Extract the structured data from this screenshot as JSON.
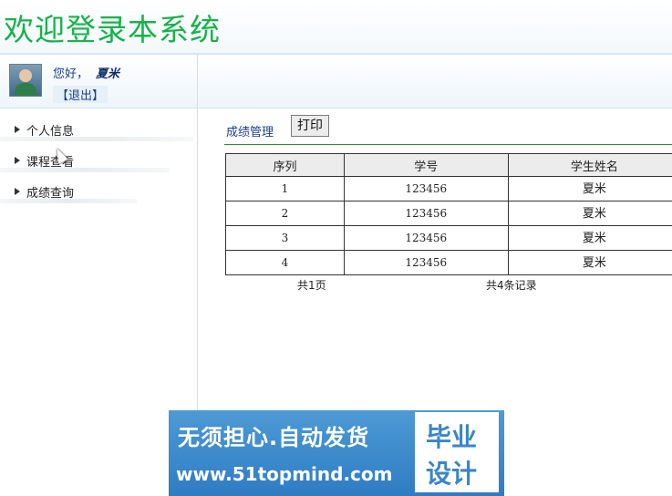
{
  "header": {
    "title": "欢迎登录本系统"
  },
  "user": {
    "greeting": "您好，",
    "name": "夏米",
    "logout": "【退出】"
  },
  "sidebar": {
    "items": [
      {
        "label": "个人信息"
      },
      {
        "label": "课程查看"
      },
      {
        "label": "成绩查询"
      }
    ]
  },
  "main": {
    "breadcrumb": "成绩管理",
    "print_label": "打印",
    "table": {
      "headers": [
        "序列",
        "学号",
        "学生姓名"
      ],
      "rows": [
        [
          "1",
          "123456",
          "夏米"
        ],
        [
          "2",
          "123456",
          "夏米"
        ],
        [
          "3",
          "123456",
          "夏米"
        ],
        [
          "4",
          "123456",
          "夏米"
        ]
      ]
    },
    "pager": {
      "pages": "共1页",
      "records": "共4条记录"
    }
  },
  "banner": {
    "slogan": "无须担心.自动发货",
    "url": "www.51topmind.com",
    "badge_line1": "毕业",
    "badge_line2": "设计"
  }
}
